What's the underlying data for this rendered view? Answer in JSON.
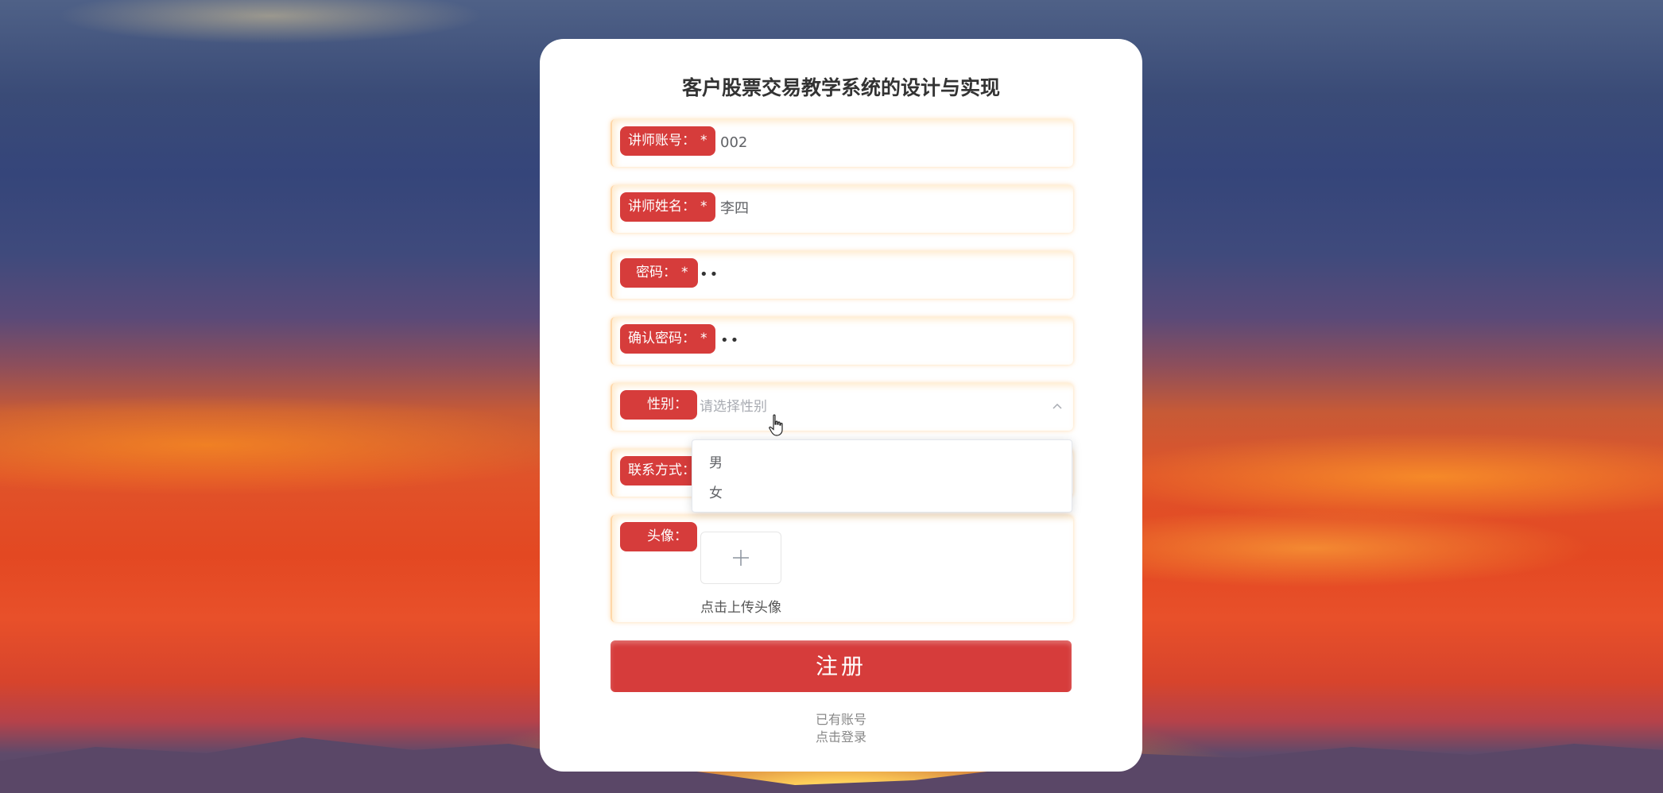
{
  "page": {
    "title": "客户股票交易教学系统的设计与实现"
  },
  "form": {
    "account": {
      "label": "讲师账号：",
      "required": "*",
      "value": "002"
    },
    "name": {
      "label": "讲师姓名：",
      "required": "*",
      "value": "李四"
    },
    "password": {
      "label": "密码：",
      "required": "*",
      "value": "••"
    },
    "confirm_password": {
      "label": "确认密码：",
      "required": "*",
      "value": "••"
    },
    "gender": {
      "label": "性别：",
      "placeholder": "请选择性别",
      "options": [
        "男",
        "女"
      ]
    },
    "contact": {
      "label": "联系方式："
    },
    "avatar": {
      "label": "头像：",
      "upload_tip": "点击上传头像"
    }
  },
  "actions": {
    "register_label": "注册",
    "have_account": "已有账号",
    "click_login": "点击登录"
  },
  "colors": {
    "accent": "#d63c3b",
    "card": "#ffffff"
  },
  "icons": {
    "chevron": "chevron-up-icon",
    "upload": "plus-icon",
    "cursor": "hand-pointer-icon"
  }
}
